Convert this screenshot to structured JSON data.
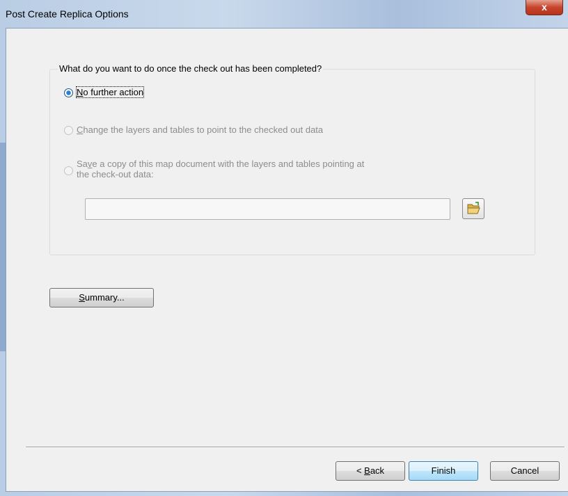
{
  "window": {
    "title": "Post Create Replica Options",
    "close_glyph": "x"
  },
  "group": {
    "legend": "What do you want to do once the check out has been completed?"
  },
  "options": [
    {
      "accel": "N",
      "rest": "o further action",
      "selected": true,
      "enabled": true
    },
    {
      "accel": "C",
      "rest": "hange the layers and tables to point to the checked out data",
      "selected": false,
      "enabled": false
    },
    {
      "pre": "Sa",
      "accel": "v",
      "rest": "e a copy of this map document with the layers and tables pointing at",
      "line2": "the check-out data:",
      "selected": false,
      "enabled": false
    }
  ],
  "path_field": {
    "value": ""
  },
  "icons": {
    "browse": "folder-open-icon"
  },
  "summary_button": {
    "accel": "S",
    "rest": "ummary..."
  },
  "footer": {
    "back_prefix": "< ",
    "back_accel": "B",
    "back_rest": "ack",
    "finish": "Finish",
    "cancel": "Cancel"
  }
}
